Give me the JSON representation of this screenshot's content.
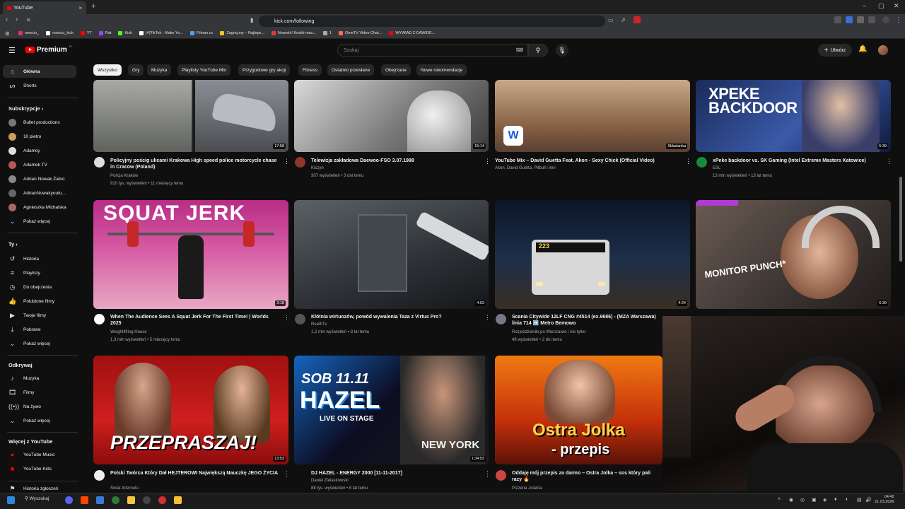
{
  "browser": {
    "tab_title": "YouTube",
    "url": "kick.com/following",
    "bookmarks": [
      {
        "label": "nowciu_",
        "color": "#e1306c"
      },
      {
        "label": "nowciu_kick",
        "color": "#ffffff"
      },
      {
        "label": "YT",
        "color": "#ff0000"
      },
      {
        "label": "Rat",
        "color": "#9146ff"
      },
      {
        "label": "Kick",
        "color": "#53fc18"
      },
      {
        "label": "(4)TikTok - Make Yo...",
        "color": "#ffffff"
      },
      {
        "label": "Filman.cc",
        "color": "#4ea1ff"
      },
      {
        "label": "Zagraj.my – Najleps...",
        "color": "#f5c518"
      },
      {
        "label": "Nowość! Kostki mas...",
        "color": "#e53935"
      },
      {
        "label": "1",
        "color": "#aaaaaa"
      },
      {
        "label": "OmeTV Video Chat...",
        "color": "#ff7043"
      },
      {
        "label": "WYWIAD Z DAWIDE...",
        "color": "#ff0000"
      }
    ]
  },
  "header": {
    "logo_text": "Premium",
    "logo_region": "PL",
    "search_placeholder": "Szukaj",
    "create_label": "Utwórz"
  },
  "sidebar": {
    "main": [
      {
        "label": "Główna",
        "icon": "home-icon"
      },
      {
        "label": "Shorts",
        "icon": "shorts-icon"
      }
    ],
    "subs_heading": "Subskrypcje",
    "subs": [
      {
        "label": "Bullet productions",
        "color": "#777"
      },
      {
        "label": "10 pietro",
        "color": "#c8a15a"
      },
      {
        "label": "Adamcy",
        "color": "#ddd"
      },
      {
        "label": "Adamek TV",
        "color": "#b55"
      },
      {
        "label": "Adrian Nowak Żalno",
        "color": "#888"
      },
      {
        "label": "AdrianNowakyoutu...",
        "color": "#666"
      },
      {
        "label": "Agnieszka Michalska",
        "color": "#a66"
      }
    ],
    "subs_more": "Pokaż więcej",
    "you_heading": "Ty",
    "you": [
      {
        "label": "Historia",
        "icon": "history-icon"
      },
      {
        "label": "Playlisty",
        "icon": "playlist-icon"
      },
      {
        "label": "Do obejrzenia",
        "icon": "clock-icon"
      },
      {
        "label": "Polubione filmy",
        "icon": "like-icon"
      },
      {
        "label": "Twoje filmy",
        "icon": "video-icon"
      },
      {
        "label": "Pobrane",
        "icon": "download-icon"
      }
    ],
    "you_more": "Pokaż więcej",
    "explore_heading": "Odkrywaj",
    "explore": [
      {
        "label": "Muzyka",
        "icon": "music-icon"
      },
      {
        "label": "Filmy",
        "icon": "film-icon"
      },
      {
        "label": "Na żywo",
        "icon": "live-icon"
      }
    ],
    "explore_more": "Pokaż więcej",
    "more_heading": "Więcej z YouTube",
    "more": [
      {
        "label": "YouTube Music",
        "icon": "youtube-music-icon"
      },
      {
        "label": "YouTube Kids",
        "icon": "youtube-kids-icon"
      }
    ],
    "last_item": "Historia zgłoszeń"
  },
  "chips": [
    "Wszystko",
    "Gry",
    "Muzyka",
    "Playlisty YouTube Mix",
    "Przygodowe gry akcji",
    "Fitness",
    "Ostatnio przesłane",
    "Obejrzane",
    "Nowe rekomendacje"
  ],
  "videos": [
    {
      "title": "Policyjny pościg ulicami Krakowa High speed police motorcycle chase in Cracow (Poland)",
      "channel": "Policja Kraków",
      "meta": "910 tys. wyświetleń • 11 miesięcy temu",
      "duration": "17:58"
    },
    {
      "title": "Telewizja zakładowa Daewoo-FSO 3.07.1998",
      "channel": "Kiczyn",
      "meta": "307 wyświetleń • 3 dni temu",
      "duration": "15:14"
    },
    {
      "title": "YouTube Mix – David Guetta Feat. Akon - Sexy Chick (Official Video)",
      "channel": "Akon, David Guetta, Pitbull i inni",
      "meta": "",
      "duration": "Składanka"
    },
    {
      "title": "xPeke backdoor vs. SK Gaming (Intel Extreme Masters Katowice)",
      "channel": "ESL",
      "meta": "13 mln wyświetleń • 13 lat temu",
      "duration": "5:39"
    },
    {
      "title": "When The Audience Sees A Squat Jerk For The First Time! | Worlds 2025",
      "channel": "Weightlifting House",
      "meta": "1,3 mln wyświetleń • 5 miesięcy temu",
      "duration": "3:18"
    },
    {
      "title": "Kłótnia wirtuozów, powód wywalenia Taza z Virtus Pro?",
      "channel": "ReathTv",
      "meta": "1,2 mln wyświetleń • 8 lat temu",
      "duration": "4:03"
    },
    {
      "title": "Scania Citywide 12LF CNG #4514 (ex.9686) - (MZA Warszawa) linia 714 ➡️ Metro Bemowo",
      "channel": "Rozjeżdżalniki po Warszawie i nie tylko",
      "meta": "48 wyświetleń • 2 dni temu",
      "duration": "4:24"
    },
    {
      "title": "",
      "channel": "",
      "meta": "",
      "duration": "6:39"
    },
    {
      "title": "Polski Twórca Który Dał HEJTEROWI Największą Nauczkę JEGO ŻYCIA",
      "channel": "Świat Internetu",
      "meta": "",
      "duration": "13:53"
    },
    {
      "title": "DJ HAZEL - ENERGY 2000 [11-11-2017]",
      "channel": "Daniel Zielaskowski",
      "meta": "88 tys. wyświetleń • 8 lat temu",
      "duration": "1:34:53"
    },
    {
      "title": "Oddaję mój przepis za darmo – Ostra Jolka – sos który pali razy 🔥",
      "channel": "Pizzeria Jolanta",
      "meta": "",
      "duration": ""
    }
  ],
  "thumb_texts": {
    "squat": "SQUAT JERK",
    "xpeke": "XPEKE BACKDOOR",
    "monitor": "MONITOR PUNCH*",
    "przepraszaj": "PRZEPRASZAJ!",
    "sob": "SOB 11.11",
    "hazel": "HAZEL",
    "live": "LIVE ON STAGE",
    "newyork": "NEW YORK",
    "jolka1": "Ostra Jolka",
    "jolka2": "- przepis",
    "bus": "223"
  },
  "taskbar": {
    "search": "Wyszukaj",
    "time": "04:42",
    "date": "21.03.2026"
  }
}
